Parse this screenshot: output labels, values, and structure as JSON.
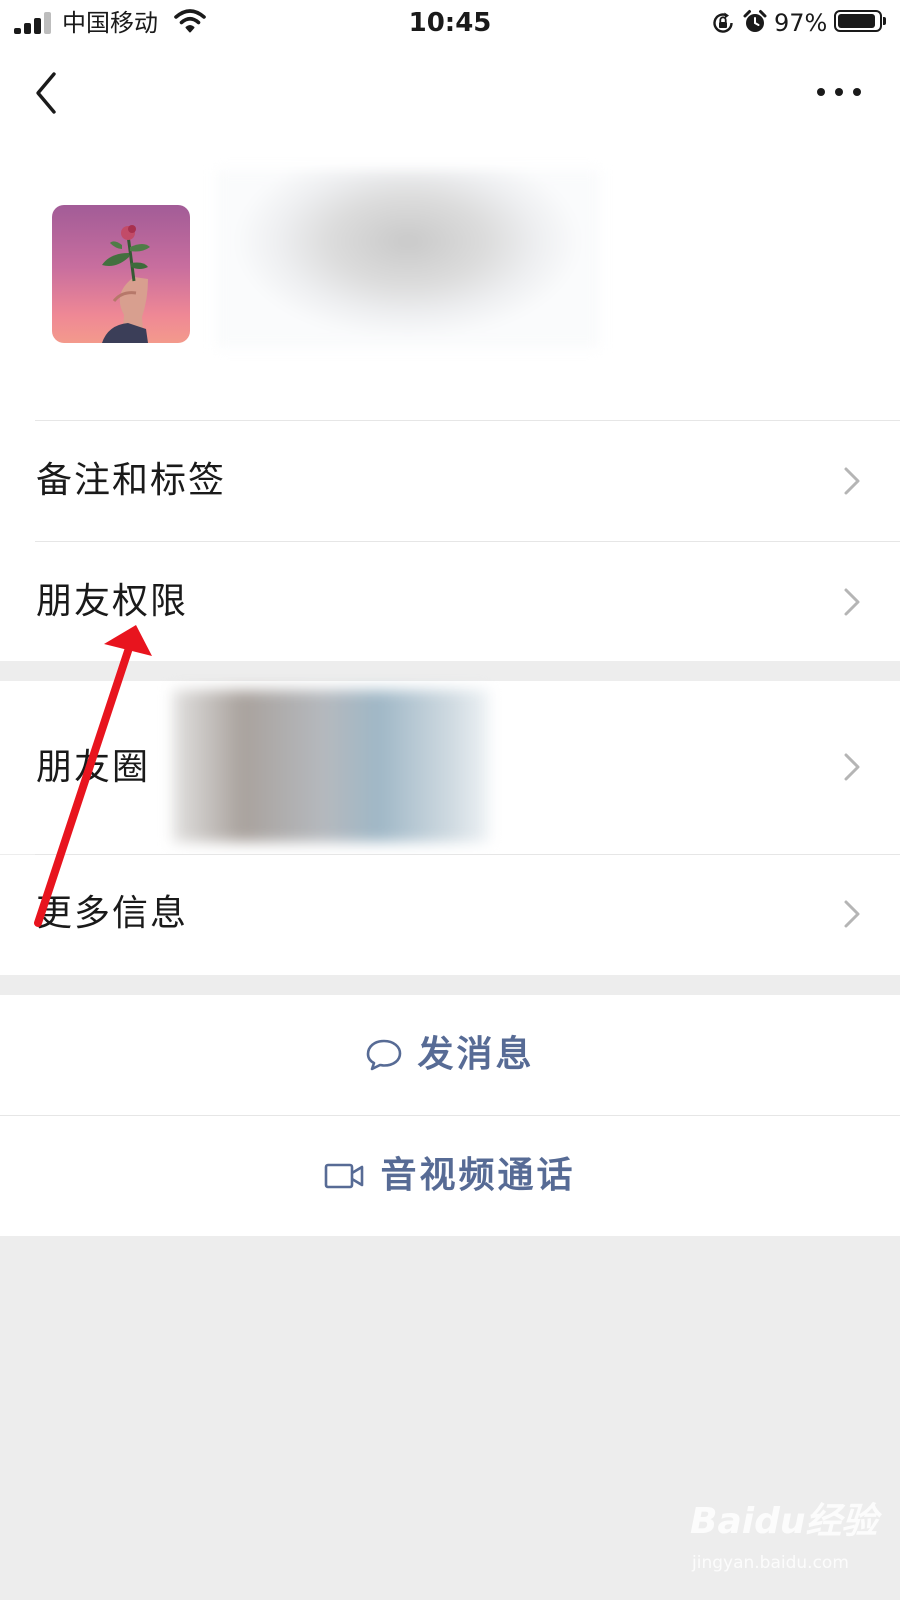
{
  "status_bar": {
    "carrier": "中国移动",
    "time": "10:45",
    "battery_percent": "97%",
    "signal_bars": 3,
    "icons": [
      "signal-icon",
      "wifi-icon",
      "rotation-lock-icon",
      "alarm-icon",
      "battery-icon"
    ]
  },
  "nav": {
    "back_icon": "chevron-left-icon",
    "more_icon": "more-dots-icon"
  },
  "profile": {
    "avatar": "rose-in-hand-photo"
  },
  "menu": {
    "remarks_tags": "备注和标签",
    "friend_permissions": "朋友权限",
    "moments": "朋友圈",
    "more_info": "更多信息"
  },
  "actions": {
    "send_message": "发消息",
    "video_call": "音视频通话"
  },
  "watermark": {
    "logo": "Baidu经验",
    "url": "jingyan.baidu.com"
  },
  "colors": {
    "action_text": "#576b95",
    "annotation_arrow": "#e8141e",
    "page_background": "#ededed",
    "card_background": "#ffffff"
  }
}
